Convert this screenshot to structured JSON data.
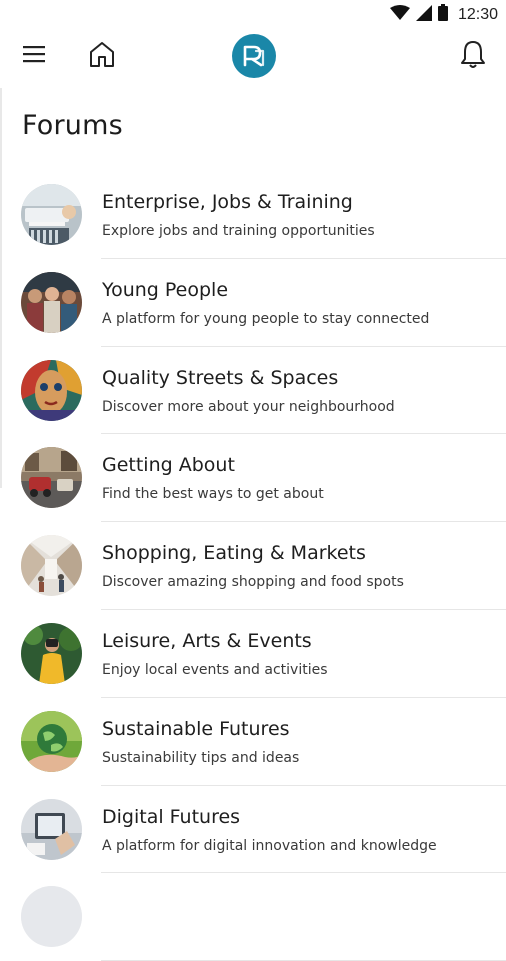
{
  "status_bar": {
    "time": "12:30",
    "icons": [
      "wifi-icon",
      "signal-icon",
      "battery-icon"
    ]
  },
  "app_bar": {
    "icons": [
      "menu-icon",
      "home-icon",
      "app-logo",
      "bell-icon"
    ],
    "accent_color": "#1a87a8"
  },
  "page": {
    "title": "Forums"
  },
  "forums": [
    {
      "title": "Enterprise, Jobs & Training",
      "description": "Explore jobs and training opportunities",
      "image": "desk-with-keyboard"
    },
    {
      "title": "Young People",
      "description": "A platform for young people to stay connected",
      "image": "group-of-young-people"
    },
    {
      "title": "Quality Streets & Spaces",
      "description": "Discover more about your neighbourhood",
      "image": "colorful-mural-face"
    },
    {
      "title": "Getting About",
      "description": "Find the best ways to get about",
      "image": "street-with-vehicles"
    },
    {
      "title": "Shopping, Eating & Markets",
      "description": "Discover amazing shopping and food spots",
      "image": "shopping-arcade"
    },
    {
      "title": "Leisure, Arts & Events",
      "description": "Enjoy local events and activities",
      "image": "person-with-camera"
    },
    {
      "title": "Sustainable Futures",
      "description": "Sustainability tips and ideas",
      "image": "hand-holding-globe"
    },
    {
      "title": "Digital Futures",
      "description": "A platform for digital innovation and knowledge",
      "image": "person-using-tablet"
    },
    {
      "title": "",
      "description": "",
      "image": "partial-item"
    }
  ]
}
